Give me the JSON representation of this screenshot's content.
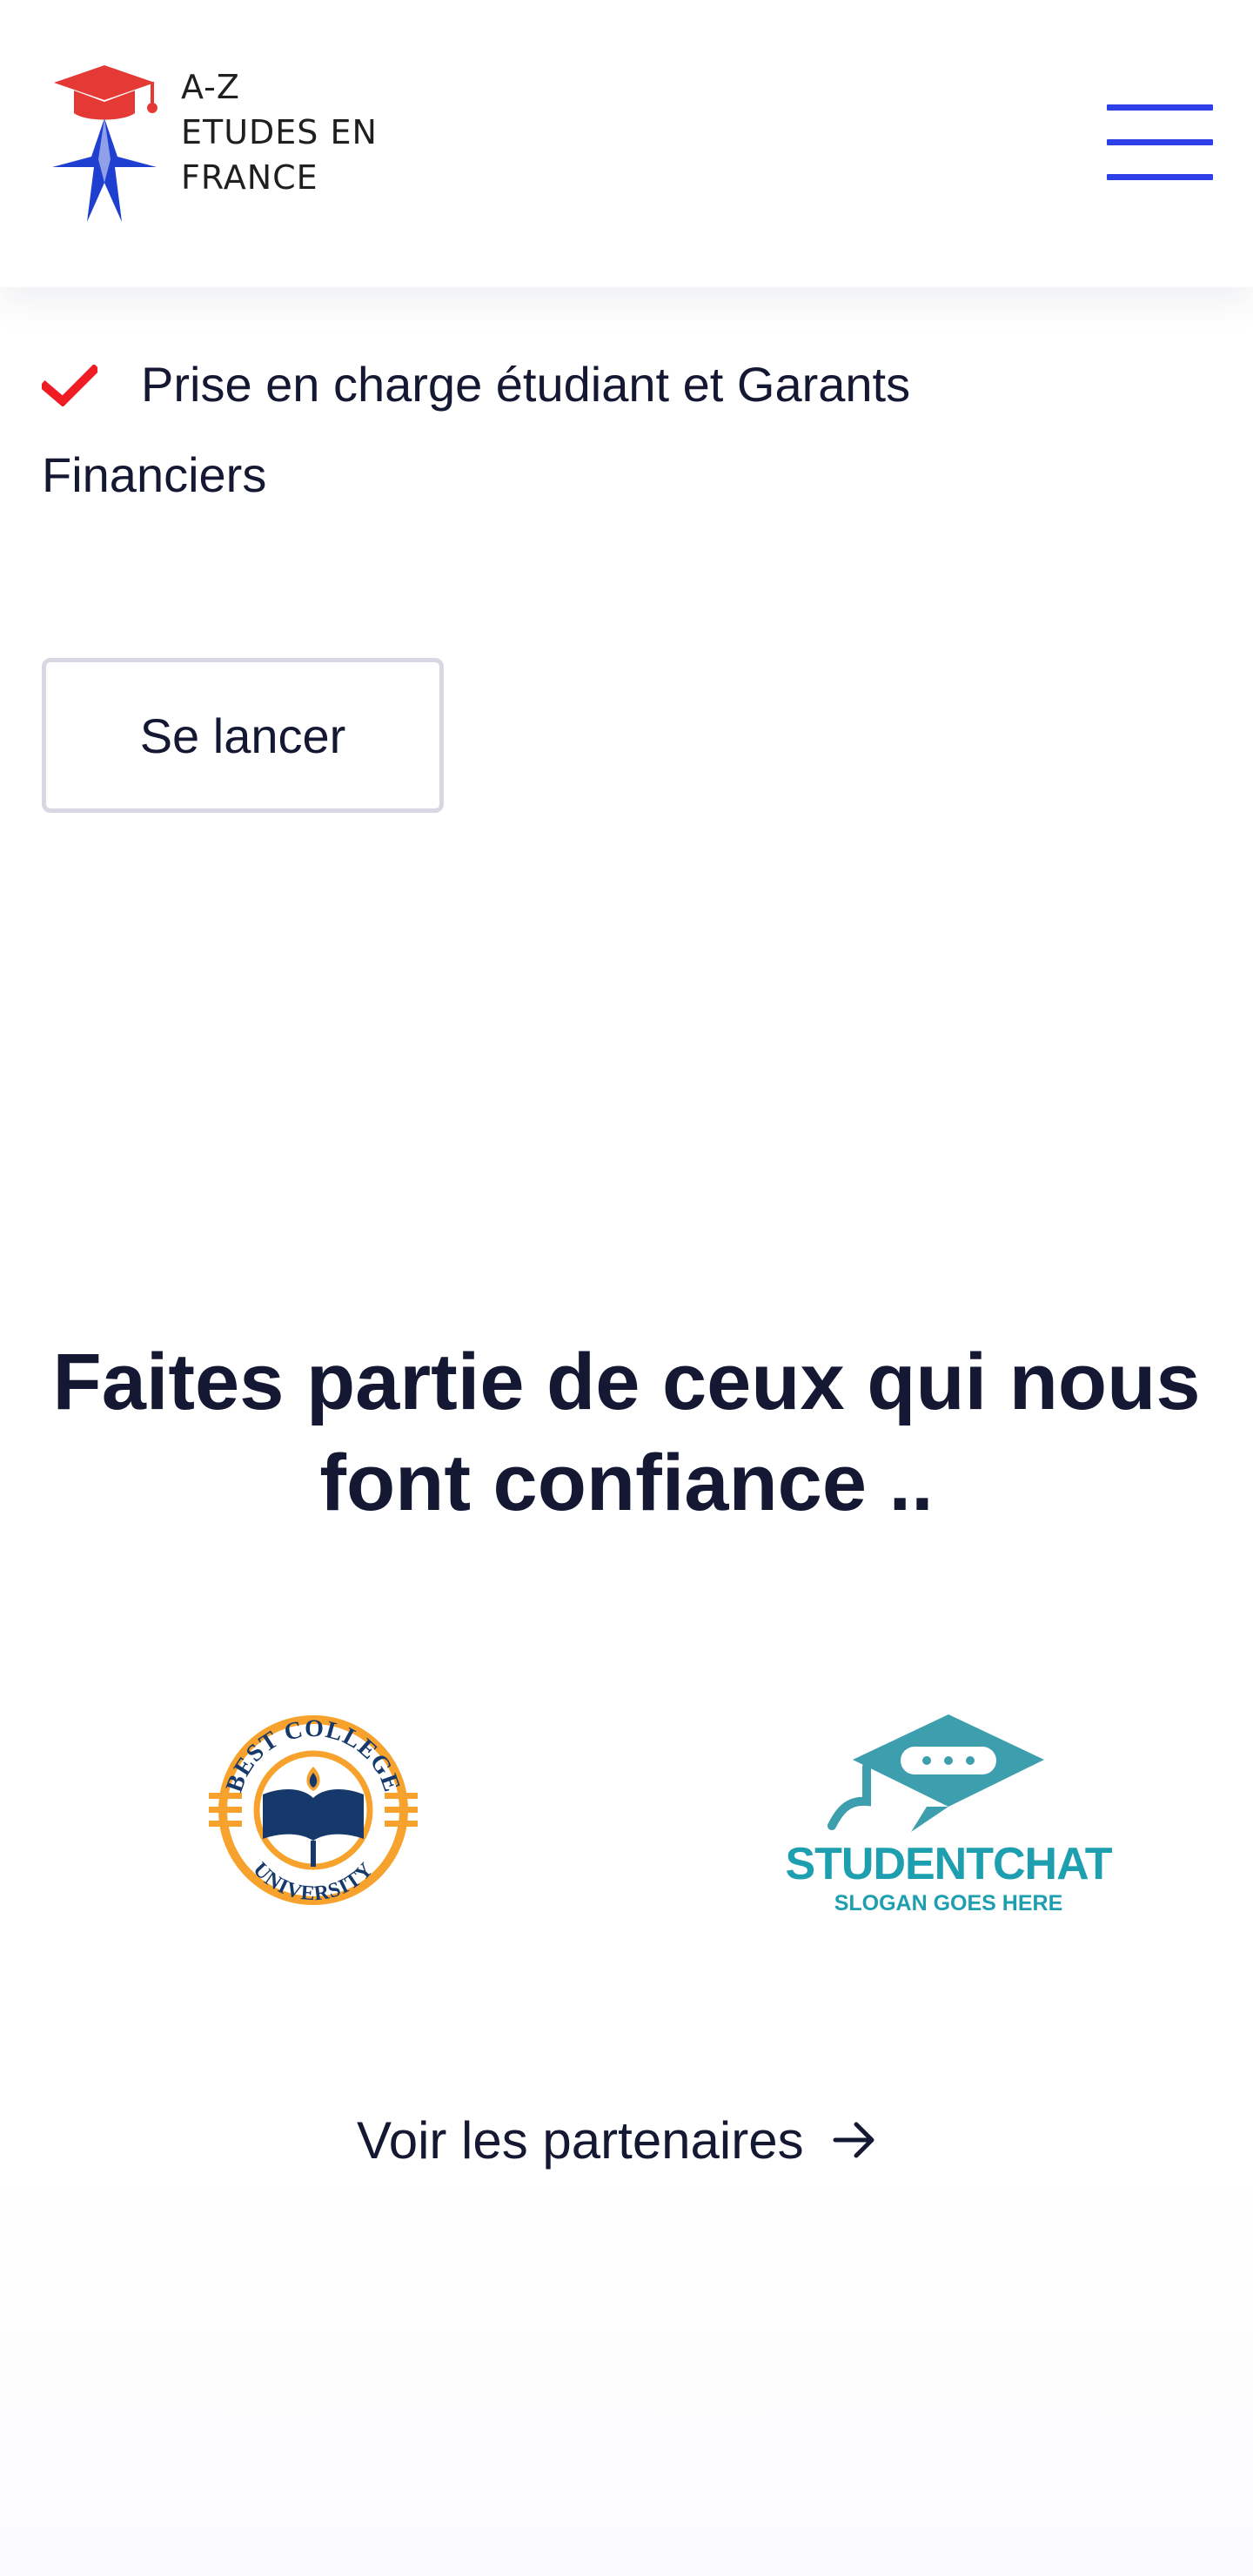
{
  "header": {
    "logo_alt_lines": [
      "A-Z",
      "ETUDES EN",
      "FRANCE"
    ],
    "menu_icon": "hamburger-menu-icon",
    "colors": {
      "menu": "#2d3fe6",
      "logo_red": "#e53935",
      "logo_blue": "#1f3fd1"
    }
  },
  "features": {
    "items": [
      {
        "icon": "check-icon",
        "text": "Prise en charge étudiant et Garants Financiers"
      }
    ],
    "check_color": "#ef1c24"
  },
  "cta": {
    "label": "Se lancer"
  },
  "trust": {
    "title": "Faites partie de ceux qui nous font confiance ..",
    "partners": [
      {
        "name": "Best College University",
        "logo_text_top": "BEST COLLEGE",
        "logo_text_bottom": "UNIVERSITY"
      },
      {
        "name": "STUDENTCHAT",
        "slogan": "SLOGAN GOES HERE"
      }
    ],
    "link_label": "Voir les partenaires",
    "link_icon": "arrow-right-icon"
  },
  "colors": {
    "text": "#141833",
    "cta_border": "#d8d8e4",
    "studentchat": "#1e9fb0",
    "best_college_orange": "#f7a22d",
    "best_college_navy": "#17386b"
  }
}
